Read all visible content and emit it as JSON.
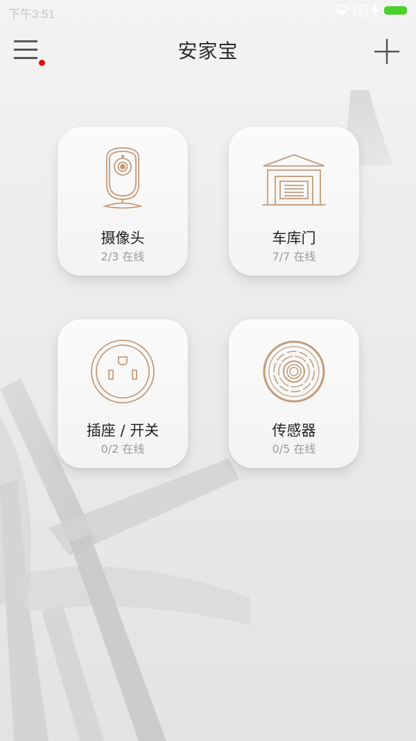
{
  "status_bar": {
    "time": "下午3:51"
  },
  "header": {
    "title": "安家宝"
  },
  "colors": {
    "accent_bronze": "#c39a78",
    "notification_dot": "#e01010",
    "battery_green": "#4cd02c"
  },
  "devices": [
    {
      "label": "摄像头",
      "status": "2/3 在线",
      "icon": "camera-icon"
    },
    {
      "label": "车库门",
      "status": "7/7 在线",
      "icon": "garage-door-icon"
    },
    {
      "label": "插座 / 开关",
      "status": "0/2 在线",
      "icon": "power-socket-icon"
    },
    {
      "label": "传感器",
      "status": "0/5 在线",
      "icon": "sensor-icon"
    }
  ]
}
